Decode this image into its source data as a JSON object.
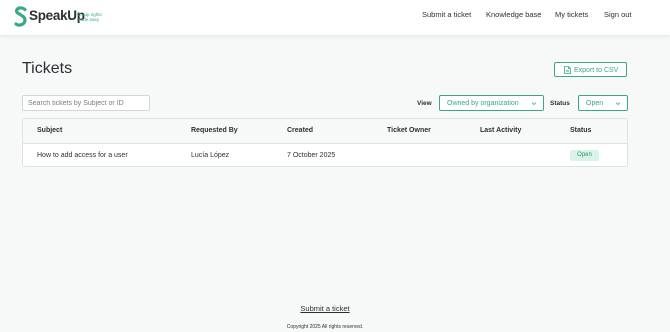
{
  "brand": {
    "name": "SpeakUp",
    "tagline": "Group rights made easy",
    "colors": {
      "accent": "#3aa884",
      "badge_bg": "#d8f3e7",
      "text": "#2c3035"
    }
  },
  "nav": {
    "submit_ticket": "Submit a ticket",
    "knowledge_base": "Knowledge base",
    "my_tickets": "My tickets",
    "sign_out": "Sign out"
  },
  "page": {
    "title": "Tickets"
  },
  "toolbar": {
    "export_label": "Export to CSV",
    "export_icon": "document-icon",
    "search_placeholder": "Search tickets by Subject or ID",
    "view_label": "View",
    "view_value": "Owned by organization",
    "status_label": "Status",
    "status_value": "Open"
  },
  "table": {
    "columns": [
      "Subject",
      "Requested By",
      "Created",
      "Ticket Owner",
      "Last Activity",
      "Status"
    ],
    "rows": [
      {
        "subject": "How to add access for a user",
        "requested_by": "Lucía López",
        "created": "7 October 2025",
        "owner": "",
        "last_activity": "",
        "status": "Open"
      }
    ]
  },
  "footer": {
    "submit_link": "Submit a ticket",
    "copyright": "Copyright 2025 All rights reserved."
  }
}
